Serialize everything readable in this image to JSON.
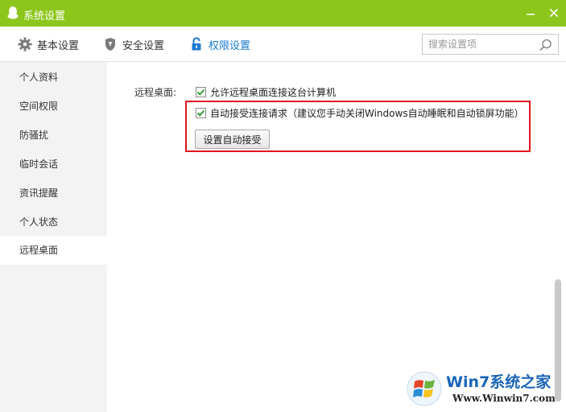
{
  "window": {
    "title": "系统设置",
    "accent_color": "#8cc61c",
    "minimize_icon": "minimize-icon",
    "close_icon": "close-icon"
  },
  "toolbar": {
    "tabs": [
      {
        "label": "基本设置",
        "icon": "gear-icon"
      },
      {
        "label": "安全设置",
        "icon": "shield-icon"
      },
      {
        "label": "权限设置",
        "icon": "lock-icon",
        "active": true
      }
    ],
    "search": {
      "placeholder": "搜索设置项",
      "value": ""
    }
  },
  "sidebar": {
    "items": [
      {
        "label": "个人资料"
      },
      {
        "label": "空间权限"
      },
      {
        "label": "防骚扰"
      },
      {
        "label": "临时会话"
      },
      {
        "label": "资讯提醒"
      },
      {
        "label": "个人状态"
      },
      {
        "label": "远程桌面",
        "active": true
      }
    ]
  },
  "main": {
    "section_label": "远程桌面:",
    "allow_remote": {
      "label": "允许远程桌面连接这台计算机",
      "checked": true
    },
    "auto_accept": {
      "label": "自动接受连接请求（建议您手动关闭Windows自动睡眠和自动锁屏功能）",
      "checked": true
    },
    "auto_accept_button": "设置自动接受",
    "highlight_color": "#e0141e"
  },
  "watermark": {
    "title": "Win7系统之家",
    "url": "Www.Winwin7.com"
  }
}
